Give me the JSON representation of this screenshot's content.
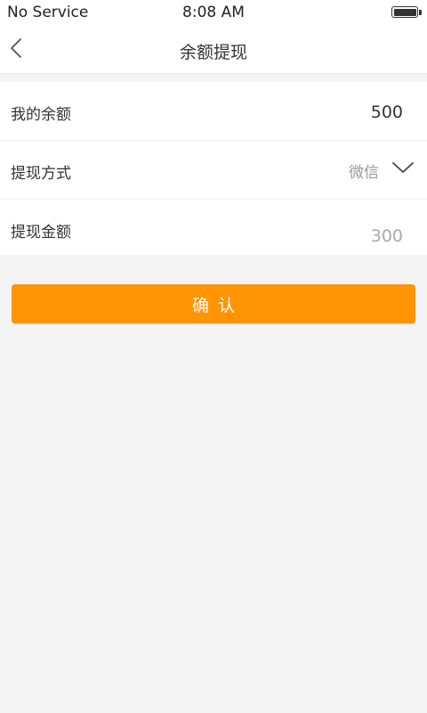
{
  "status_bar": {
    "carrier": "No Service",
    "time": "8:08 AM",
    "battery_level": 1.0
  },
  "nav": {
    "title": "余额提现",
    "back_icon": "chevron-left-icon"
  },
  "form": {
    "balance": {
      "label": "我的余额",
      "value": "500"
    },
    "method": {
      "label": "提现方式",
      "selected": "微信",
      "icon": "chevron-down-icon"
    },
    "amount": {
      "label": "提现金额",
      "placeholder": "300",
      "value": ""
    }
  },
  "confirm_button": {
    "label": "确认"
  },
  "colors": {
    "accent": "#ff9405",
    "background": "#f4f4f4",
    "surface": "#ffffff",
    "text": "#333333",
    "muted": "#999999"
  }
}
